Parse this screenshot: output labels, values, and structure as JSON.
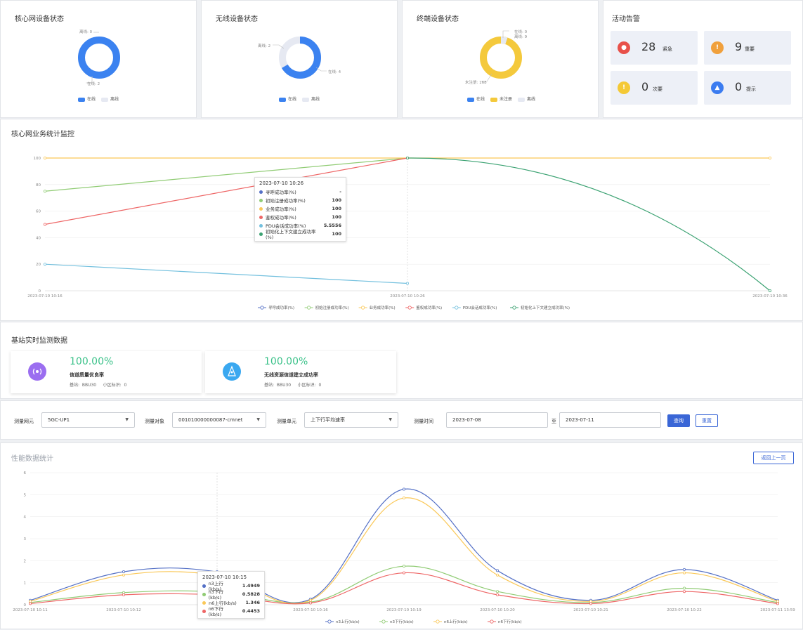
{
  "panels": {
    "core": {
      "title": "核心网设备状态",
      "offline": "离线: 0",
      "online": "在线: 2",
      "legend": [
        "在线",
        "离线"
      ]
    },
    "wireless": {
      "title": "无线设备状态",
      "offline": "离线: 2",
      "online": "在线: 4",
      "legend": [
        "在线",
        "离线"
      ]
    },
    "terminal": {
      "title": "终端设备状态",
      "online": "在线: 0",
      "offline": "离线: 9",
      "unregistered": "未注册: 168",
      "legend": [
        "在线",
        "未注册",
        "离线"
      ]
    },
    "alerts": {
      "title": "活动告警",
      "items": [
        {
          "count": "28",
          "label": "紧急",
          "color": "#e8514a"
        },
        {
          "count": "9",
          "label": "重要",
          "color": "#f0a03c"
        },
        {
          "count": "0",
          "label": "次要",
          "color": "#f4c936"
        },
        {
          "count": "0",
          "label": "提示",
          "color": "#3b7cf0"
        }
      ]
    }
  },
  "core_monitor": {
    "title": "核心网业务统计监控",
    "tooltip": {
      "time": "2023-07-10 10:26",
      "rows": [
        {
          "name": "寻呼成功率(%)",
          "value": "-",
          "color": "#5470c6"
        },
        {
          "name": "初始注册成功率(%)",
          "value": "100",
          "color": "#91cc75"
        },
        {
          "name": "业务成功率(%)",
          "value": "100",
          "color": "#fac858"
        },
        {
          "name": "鉴权成功率(%)",
          "value": "100",
          "color": "#ee6666"
        },
        {
          "name": "PDU会话成功率(%)",
          "value": "5.5556",
          "color": "#73c0de"
        },
        {
          "name": "初始化上下文建立成功率(%)",
          "value": "100",
          "color": "#3ba272"
        }
      ]
    }
  },
  "base_station": {
    "title": "基站实时监测数据",
    "cards": [
      {
        "pct": "100.00%",
        "name": "信道质量优良率",
        "sub": "基站:  BBU30     小区标识:  0",
        "color": "#9b6ef0"
      },
      {
        "pct": "100.00%",
        "name": "无线资源信道建立成功率",
        "sub": "基站:  BBU30     小区标识:  0",
        "color": "#3aa8f0"
      }
    ]
  },
  "filters": {
    "ne_label": "测量网元",
    "ne_value": "5GC-UP1",
    "obj_label": "测量对象",
    "obj_value": "001010000000087-cmnet",
    "unit_label": "测量单元",
    "unit_value": "上下行平均速率",
    "time_label": "测量时间",
    "start": "2023-07-08",
    "to": "至",
    "end": "2023-07-11",
    "query": "查询",
    "reset": "重置"
  },
  "perf": {
    "title": "性能数据统计",
    "back": "返回上一页",
    "tooltip": {
      "time": "2023-07-10 10:15",
      "rows": [
        {
          "name": "n3上行(kb/s)",
          "value": "1.4949",
          "color": "#5470c6"
        },
        {
          "name": "n3下行(kb/s)",
          "value": "0.5828",
          "color": "#91cc75"
        },
        {
          "name": "n6上行(kb/s)",
          "value": "1.346",
          "color": "#fac858"
        },
        {
          "name": "n6下行(kb/s)",
          "value": "0.4453",
          "color": "#ee6666"
        }
      ]
    }
  },
  "chart_data": [
    {
      "type": "pie",
      "title": "核心网设备状态",
      "labels": [
        "在线",
        "离线"
      ],
      "values": [
        2,
        0
      ],
      "colors": [
        "#3b82f0",
        "#e6e9f2"
      ]
    },
    {
      "type": "pie",
      "title": "无线设备状态",
      "labels": [
        "在线",
        "离线"
      ],
      "values": [
        4,
        2
      ],
      "colors": [
        "#3b82f0",
        "#e6e9f2"
      ]
    },
    {
      "type": "pie",
      "title": "终端设备状态",
      "labels": [
        "在线",
        "未注册",
        "离线"
      ],
      "values": [
        0,
        168,
        9
      ],
      "colors": [
        "#3b82f0",
        "#f4c93c",
        "#e6e9f2"
      ]
    },
    {
      "type": "line",
      "title": "核心网业务统计监控",
      "ylim": [
        0,
        100
      ],
      "yticks": [
        0,
        20,
        40,
        60,
        80,
        100
      ],
      "x": [
        "2023-07-10 10:16",
        "2023-07-10 10:26",
        "2023-07-10 10:36"
      ],
      "series": [
        {
          "name": "寻呼成功率(%)",
          "color": "#5470c6",
          "values": [
            null,
            null,
            null
          ]
        },
        {
          "name": "初始注册成功率(%)",
          "color": "#91cc75",
          "values": [
            75,
            100,
            null
          ]
        },
        {
          "name": "业务成功率(%)",
          "color": "#fac858",
          "values": [
            100,
            100,
            100
          ]
        },
        {
          "name": "鉴权成功率(%)",
          "color": "#ee6666",
          "values": [
            50,
            100,
            null
          ]
        },
        {
          "name": "PDU会话成功率(%)",
          "color": "#73c0de",
          "values": [
            20,
            5.5556,
            null
          ]
        },
        {
          "name": "初始化上下文建立成功率(%)",
          "color": "#3ba272",
          "values": [
            null,
            100,
            0
          ]
        }
      ]
    },
    {
      "type": "line",
      "title": "性能数据统计",
      "ylim": [
        0,
        6
      ],
      "yticks": [
        0,
        1,
        2,
        3,
        4,
        5,
        6
      ],
      "x": [
        "2023-07-10 10:11",
        "2023-07-10 10:12",
        "2023-07-10 10:15",
        "2023-07-10 10:16",
        "2023-07-10 10:19",
        "2023-07-10 10:20",
        "2023-07-10 10:21",
        "2023-07-10 10:22",
        "2023-07-11 13:59"
      ],
      "series": [
        {
          "name": "n3上行(kb/s)",
          "color": "#5470c6",
          "values": [
            0.2,
            1.5,
            1.4949,
            0.25,
            5.25,
            1.55,
            0.2,
            1.6,
            0.2
          ]
        },
        {
          "name": "n3下行(kb/s)",
          "color": "#91cc75",
          "values": [
            0.1,
            0.55,
            0.5828,
            0.12,
            1.75,
            0.6,
            0.1,
            0.75,
            0.1
          ]
        },
        {
          "name": "n6上行(kb/s)",
          "color": "#fac858",
          "values": [
            0.15,
            1.35,
            1.346,
            0.2,
            4.85,
            1.35,
            0.15,
            1.45,
            0.15
          ]
        },
        {
          "name": "n6下行(kb/s)",
          "color": "#ee6666",
          "values": [
            0.05,
            0.45,
            0.4453,
            0.08,
            1.45,
            0.45,
            0.05,
            0.6,
            0.05
          ]
        }
      ]
    }
  ]
}
